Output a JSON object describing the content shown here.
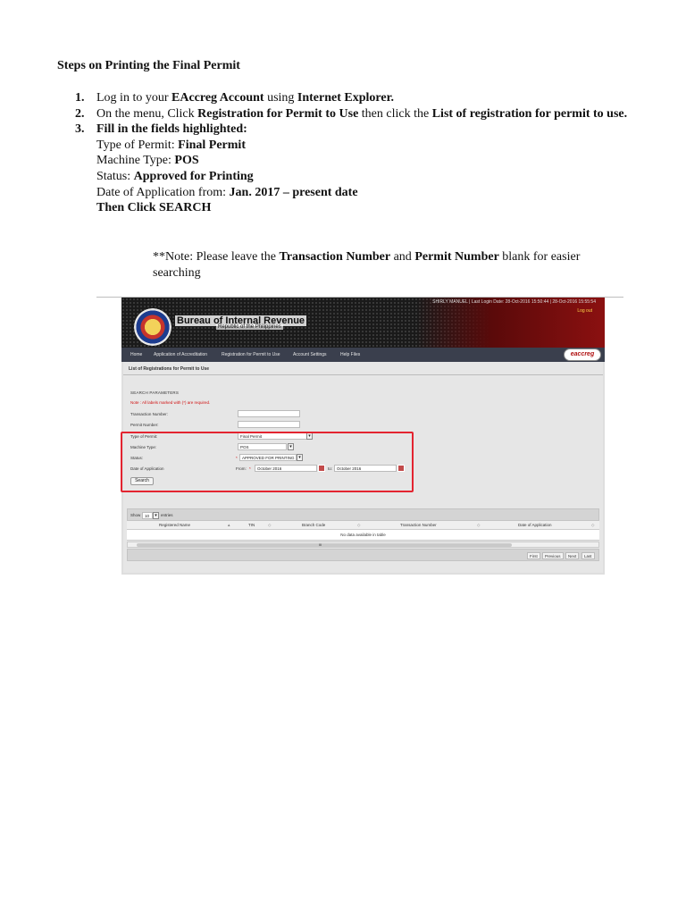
{
  "document": {
    "title": "Steps on Printing the Final Permit",
    "steps": [
      {
        "num": "1.",
        "pre": "Log in to your ",
        "b1": "EAccreg Account",
        "mid": " using ",
        "b2": "Internet Explorer."
      },
      {
        "num": "2.",
        "pre": "On the menu, Click ",
        "b1": "Registration for Permit to Use",
        "mid": " then click the ",
        "b2": "List of registration for permit to use."
      },
      {
        "num": "3.",
        "head": "Fill in the  fields highlighted:",
        "lines": [
          {
            "label": "Type of Permit: ",
            "value": "Final Permit"
          },
          {
            "label": "Machine Type: ",
            "value": "POS"
          },
          {
            "label": "Status: ",
            "value": "Approved for Printing"
          },
          {
            "label": "Date of Application from:  ",
            "value": "Jan. 2017 – present date"
          }
        ],
        "tail": "Then Click SEARCH"
      }
    ],
    "note": {
      "pre": "**Note: Please leave the ",
      "b1": "Transaction Number",
      "mid": " and ",
      "b2": "Permit Number",
      "post": " blank for easier searching"
    }
  },
  "screenshot": {
    "header": {
      "org_name": "Bureau of Internal Revenue",
      "org_sub": "Republic of the Philippines",
      "user_line": "SHIRLY MANUEL  |  Last Login Date: 28-Oct-2016 15:50:44  |  28-Oct-2016 15:55:54",
      "logout": "Log out"
    },
    "nav": [
      "Home",
      "Application of Accreditation",
      "Registration for Permit to Use",
      "Account Settings",
      "Help Files"
    ],
    "logo_text": "eaccreg",
    "page_title": "List of Registrations for Permit to Use",
    "form": {
      "section": "SEARCH PARAMETERS",
      "required_note": "Note : All labels marked with (*) are required.",
      "labels": {
        "transaction": "Transaction Number:",
        "permit": "Permit Number:",
        "type": "Type of Permit:",
        "machine": "Machine Type:",
        "status": "Status:",
        "date": "Date of Application"
      },
      "values": {
        "transaction": "",
        "permit": "",
        "type": "Final Permit",
        "machine": "POS",
        "status": "APPROVED FOR PRINTING",
        "date_from_label": "From:",
        "date_from": "October 2016",
        "date_to_label": "to:",
        "date_to": "October 2016"
      },
      "required_star": "*",
      "search_button": "Search"
    },
    "table": {
      "show_label": "Show",
      "show_value": "10",
      "entries_label": "entries",
      "columns": [
        "Registered Name",
        "TIN",
        "Branch Code",
        "Transaction Number",
        "Date of Application"
      ],
      "empty_message": "No data available in table",
      "scroll_mark": "III",
      "pagination": [
        "First",
        "Previous",
        "Next",
        "Last"
      ]
    }
  }
}
